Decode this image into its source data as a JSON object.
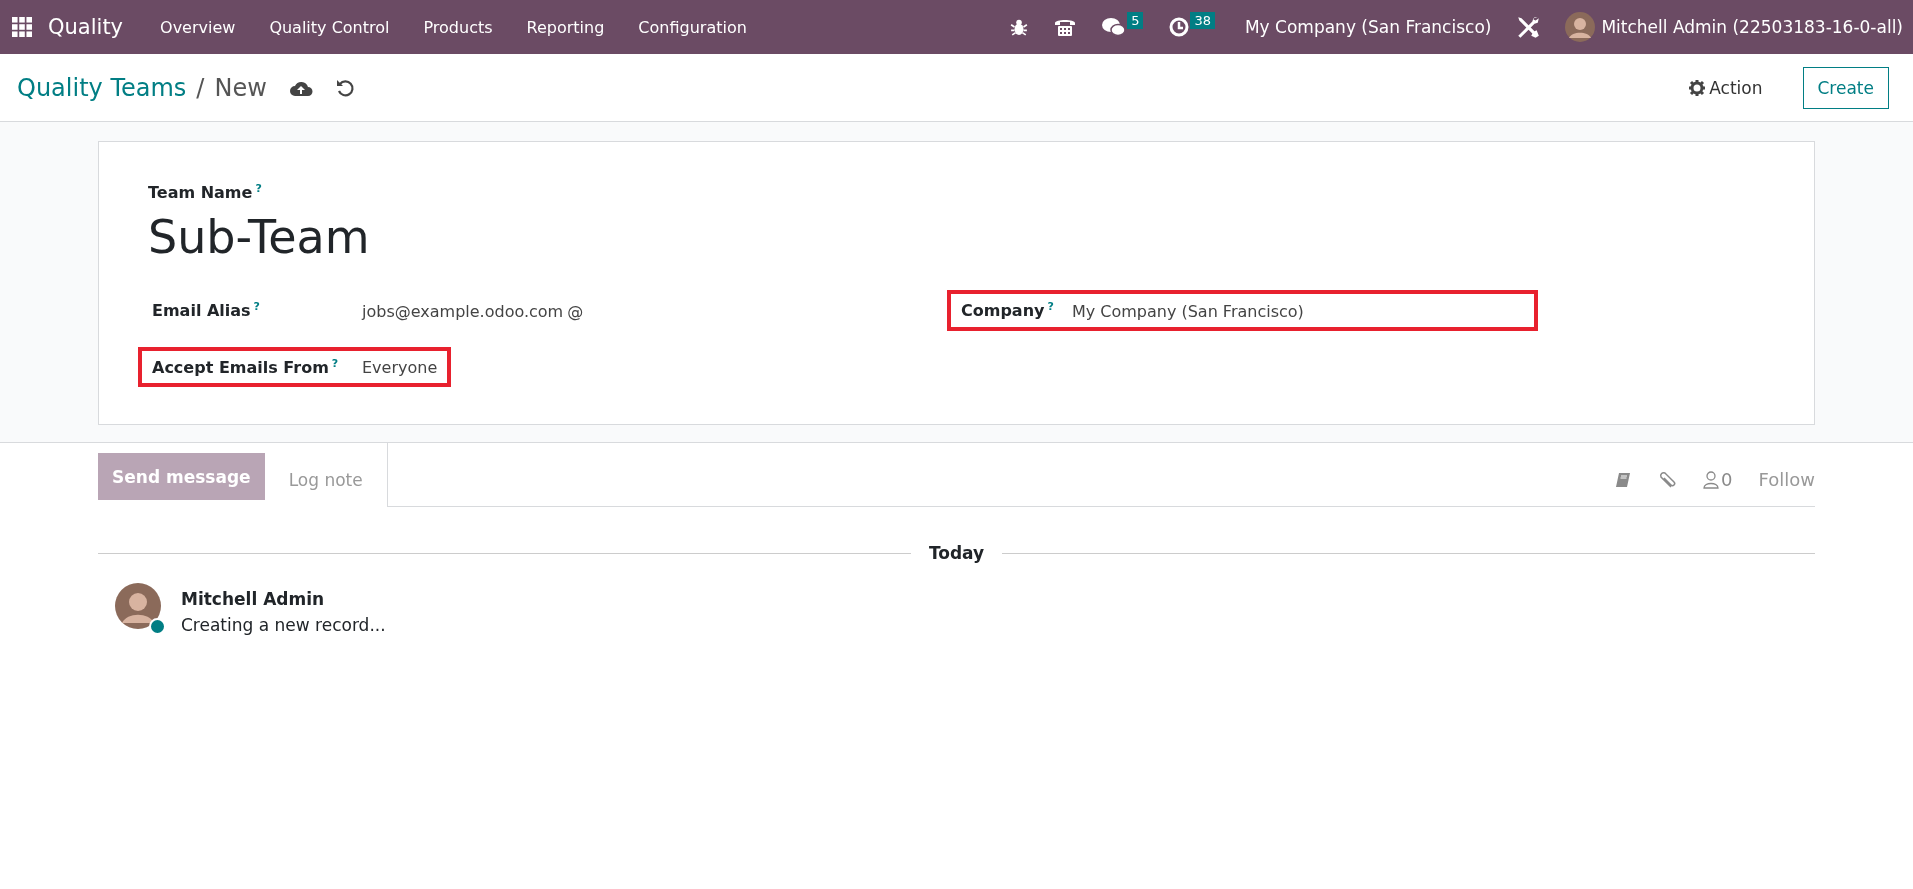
{
  "navbar": {
    "app_name": "Quality",
    "menu": [
      "Overview",
      "Quality Control",
      "Products",
      "Reporting",
      "Configuration"
    ],
    "systray": [
      {
        "kind": "bug"
      },
      {
        "kind": "phone"
      },
      {
        "kind": "chat",
        "badge": "5"
      },
      {
        "kind": "clock",
        "badge": "38"
      }
    ],
    "company": "My Company (San Francisco)",
    "user": "Mitchell Admin (22503183-16-0-all)"
  },
  "control_panel": {
    "breadcrumb": "Quality Teams",
    "separator": "/",
    "current": "New",
    "action": "Action",
    "create": "Create"
  },
  "form": {
    "name_label": "Team Name",
    "help": "?",
    "name": "Sub-Team",
    "left_column": [
      {
        "label": "Email Alias",
        "value": "jobs@example.odoo.com",
        "suffix": "@",
        "highlighted": false
      },
      {
        "label": "Accept Emails From",
        "value": "Everyone",
        "highlighted": true
      }
    ],
    "right_column": [
      {
        "label": "Company",
        "value": "My Company (San Francisco)",
        "highlighted": true
      }
    ]
  },
  "chatter": {
    "send_message": "Send message",
    "log_note": "Log note",
    "followers": "0",
    "follow": "Follow",
    "date_separator": "Today",
    "messages": [
      {
        "author": "Mitchell Admin",
        "body": "Creating a new record..."
      }
    ]
  }
}
